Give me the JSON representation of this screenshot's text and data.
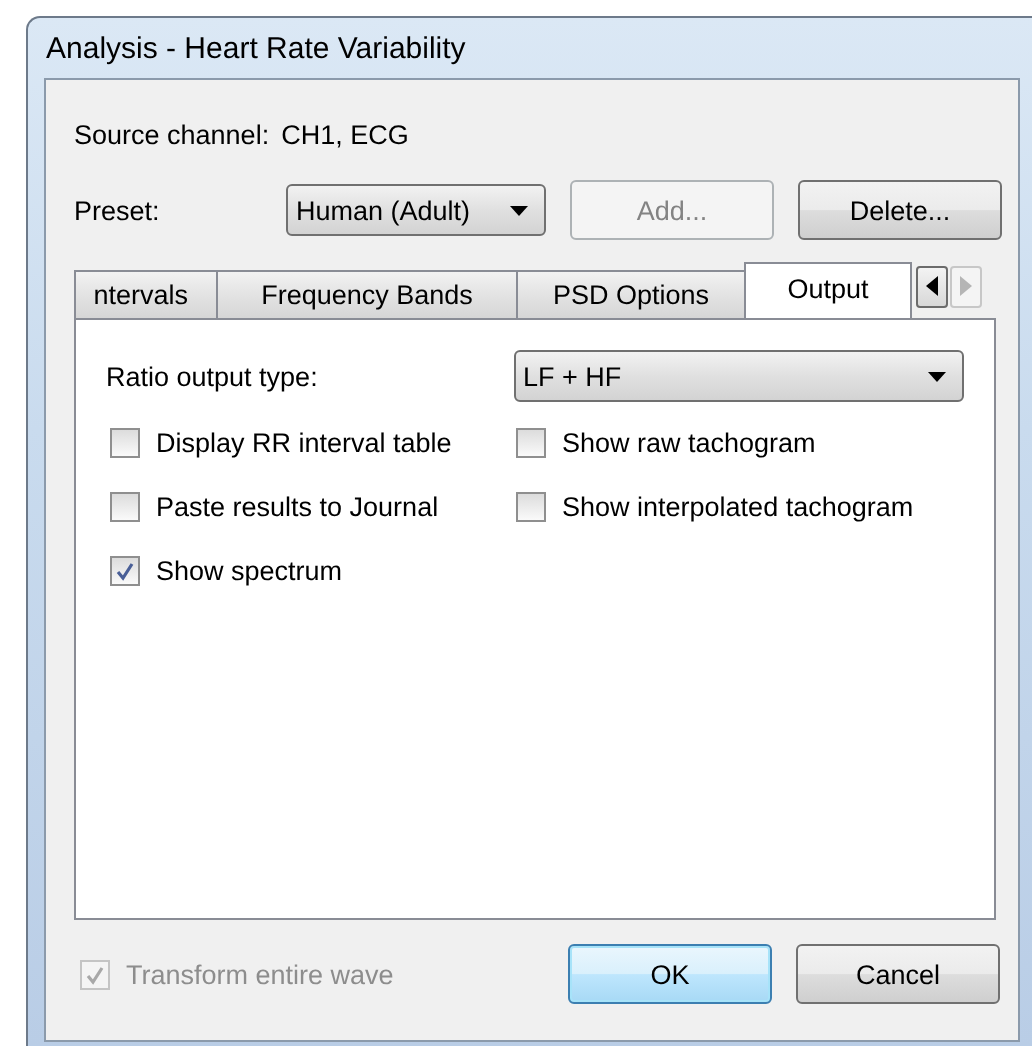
{
  "window": {
    "title": "Analysis - Heart Rate Variability"
  },
  "source_channel": {
    "label": "Source channel:",
    "value": "CH1, ECG"
  },
  "preset": {
    "label": "Preset:",
    "value": "Human (Adult)",
    "buttons": [
      {
        "label": "Add...",
        "disabled": true
      },
      {
        "label": "Delete...",
        "disabled": false
      }
    ]
  },
  "tabs": [
    {
      "label": "ntervals",
      "selected": false
    },
    {
      "label": "Frequency Bands",
      "selected": false
    },
    {
      "label": "PSD Options",
      "selected": false
    },
    {
      "label": "Output",
      "selected": true
    }
  ],
  "tab_scroll_buttons": [
    {
      "disabled": false
    },
    {
      "disabled": true
    }
  ],
  "output": {
    "ratio_label": "Ratio output type:",
    "ratio_value": "LF + HF",
    "options": [
      {
        "label": "Display RR interval table",
        "checked": false
      },
      {
        "label": "Show raw tachogram",
        "checked": false
      },
      {
        "label": "Paste results to Journal",
        "checked": false
      },
      {
        "label": "Show interpolated tachogram",
        "checked": false
      },
      {
        "label": "Show spectrum",
        "checked": true
      }
    ]
  },
  "transform": {
    "label": "Transform entire wave",
    "checked": true,
    "disabled": true
  },
  "buttons": [
    {
      "label": "OK",
      "default": true
    },
    {
      "label": "Cancel",
      "default": false
    }
  ]
}
